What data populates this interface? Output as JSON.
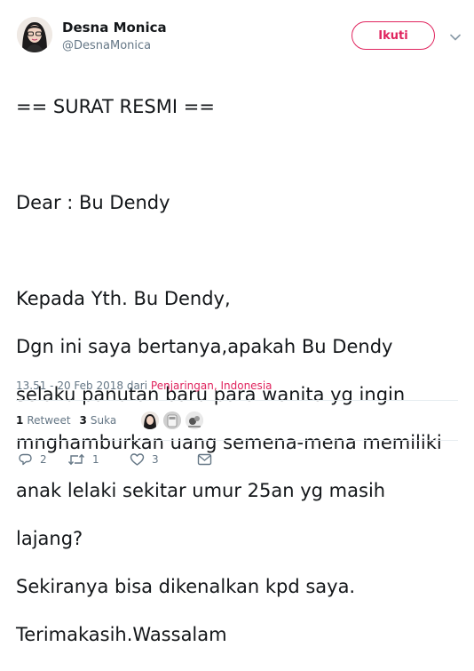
{
  "user": {
    "name": "Desna Monica",
    "handle": "@DesnaMonica"
  },
  "follow_label": "Ikuti",
  "tweet": {
    "lines": [
      "== SURAT RESMI ==",
      "",
      "Dear : Bu Dendy",
      "",
      "Kepada Yth. Bu Dendy,",
      "Dgn ini saya bertanya,apakah Bu Dendy",
      "selaku panutan baru para wanita yg ingin",
      "mnghamburkan uang semena-mena memiliki",
      "anak lelaki sekitar umur 25an yg masih",
      "lajang?",
      "Sekiranya bisa dikenalkan kpd saya.",
      "Terimakasih.Wassalam"
    ],
    "timestamp": "13.51 - 20 Feb 2018",
    "from_label": "dari",
    "location": "Penjaringan, Indonesia"
  },
  "stats": {
    "retweets_count": "1",
    "retweets_label": "Retweet",
    "likes_count": "3",
    "likes_label": "Suka"
  },
  "actions": {
    "reply_count": "2",
    "retweet_count": "1",
    "like_count": "3"
  },
  "colors": {
    "accent": "#e0245e",
    "muted": "#657786",
    "text": "#14171a",
    "divider": "#e6ecf0"
  }
}
